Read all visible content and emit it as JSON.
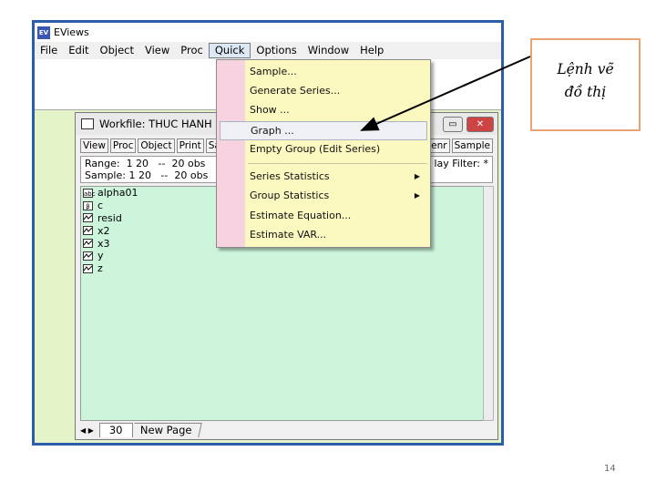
{
  "app": {
    "title": "EViews"
  },
  "menubar": [
    "File",
    "Edit",
    "Object",
    "View",
    "Proc",
    "Quick",
    "Options",
    "Window",
    "Help"
  ],
  "workfile": {
    "title": "Workfile: THUC HANH",
    "toolbar": [
      "View",
      "Proc",
      "Object",
      "Print",
      "Sa"
    ],
    "toolbar_right": [
      "Genr",
      "Sample"
    ],
    "range_line": "Range:  1 20   --  20 obs",
    "sample_line": "Sample: 1 20   --  20 obs",
    "filter_text": "lay Filter: *",
    "objects": [
      {
        "icon": "abc",
        "name": "alpha01"
      },
      {
        "icon": "β",
        "name": "c"
      },
      {
        "icon": "series",
        "name": "resid"
      },
      {
        "icon": "series",
        "name": "x2"
      },
      {
        "icon": "series",
        "name": "x3"
      },
      {
        "icon": "series",
        "name": "y"
      },
      {
        "icon": "series",
        "name": "z"
      }
    ],
    "tabs": [
      "30",
      "New Page"
    ]
  },
  "quick_menu": {
    "items": [
      "Sample...",
      "Generate Series...",
      "Show ...",
      "Graph ...",
      "Empty Group (Edit Series)",
      "Series Statistics",
      "Group Statistics",
      "Estimate Equation...",
      "Estimate VAR..."
    ]
  },
  "callout": {
    "line1": "Lệnh vẽ",
    "line2": "đồ thị"
  },
  "page_number": "14",
  "colors": {
    "frame": "#2b5ea9",
    "menu_bg": "#fbf8c0",
    "menu_strip": "#f7d3df",
    "list_bg": "#ccf5dc",
    "desk": "#e4f4c8",
    "callout_border": "#e8a473"
  }
}
